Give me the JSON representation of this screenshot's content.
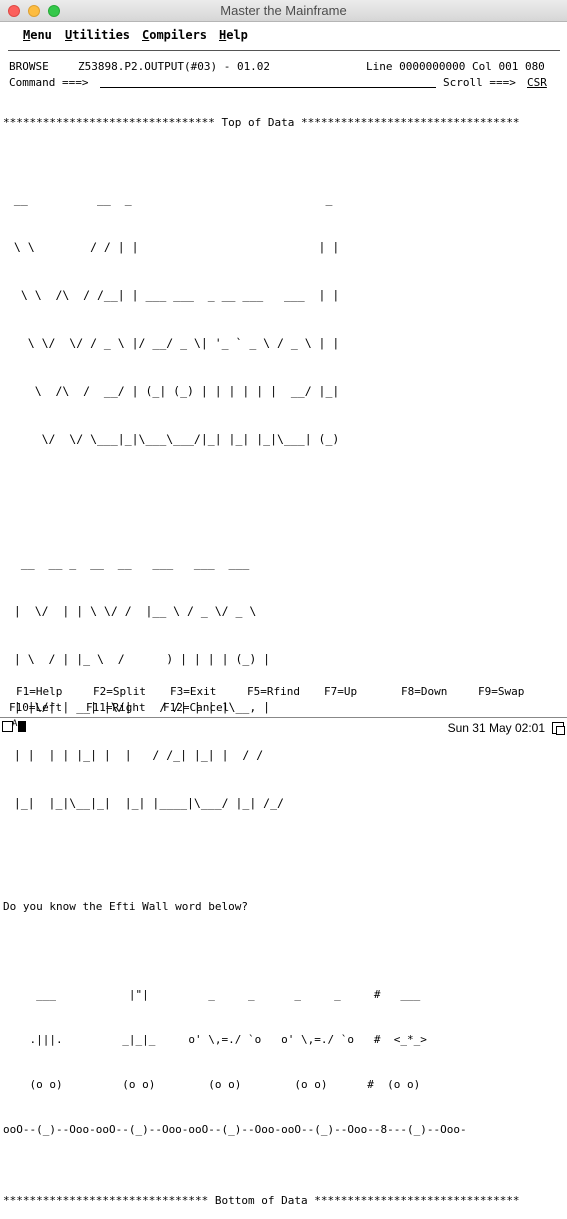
{
  "window": {
    "title": "Master the Mainframe"
  },
  "menu": {
    "items": [
      {
        "first": "M",
        "rest": "enu"
      },
      {
        "first": "U",
        "rest": "tilities"
      },
      {
        "first": "C",
        "rest": "ompilers"
      },
      {
        "first": "H",
        "rest": "elp"
      }
    ]
  },
  "header": {
    "mode": "BROWSE",
    "dataset": "Z53898.P2.OUTPUT(#03) - 01.02",
    "position": "Line 0000000000 Col 001 080",
    "command_label": "Command ===>",
    "command_value": "",
    "scroll_label": "Scroll ===>",
    "scroll_value": "CSR"
  },
  "data": {
    "top_marker": "******************************** Top of Data *********************************",
    "ascii_welcome": [
      " __          __  _                            _ ",
      " \\ \\        / / | |                          | |",
      "  \\ \\  /\\  / /__| | ___ ___  _ __ ___   ___  | |",
      "   \\ \\/  \\/ / _ \\ |/ __/ _ \\| '_ ` _ \\ / _ \\ | |",
      "    \\  /\\  /  __/ | (_| (_) | | | | | |  __/ |_|",
      "     \\/  \\/ \\___|_|\\___\\___/|_| |_| |_|\\___| (_)"
    ],
    "ascii_ibm_z": [
      "  __  __ _  __  __   ___   ___  ___ ",
      " |  \\/  | | \\ \\/ /  |__ \\ / _ \\/ _ \\",
      " | \\  / | |_ \\  /      ) | | | | (_) |",
      " | |\\/| | __| |\\/|    / /| | | |\\__, |",
      " | |  | | |_| |  |   / /_| |_| |  / / ",
      " |_|  |_|\\__|_|  |_| |____|\\___/ |_| /_/ "
    ],
    "question": "Do you know the Efti Wall word below?",
    "puzzle": [
      "     ___           |\"|         _     _      _     _     #   ___",
      "    .|||.         _|_|_     o' \\,=./ `o   o' \\,=./ `o   #  <_*_>",
      "    (o o)         (o o)        (o o)        (o o)      #  (o o)",
      "ooO--(_)--Ooo-ooO--(_)--Ooo-ooO--(_)--Ooo-ooO--(_)--Ooo--8---(_)--Ooo-"
    ],
    "bottom_marker": "******************************* Bottom of Data *******************************"
  },
  "fkeys": {
    "row1": [
      "F1=Help",
      "F2=Split",
      "F3=Exit",
      "F5=Rfind",
      "F7=Up",
      "F8=Down",
      "F9=Swap"
    ],
    "row2": [
      "F10=Left",
      "F11=Right",
      "F12=Cancel"
    ]
  },
  "status": {
    "indicator": "A",
    "datetime": "Sun 31 May 02:01"
  }
}
